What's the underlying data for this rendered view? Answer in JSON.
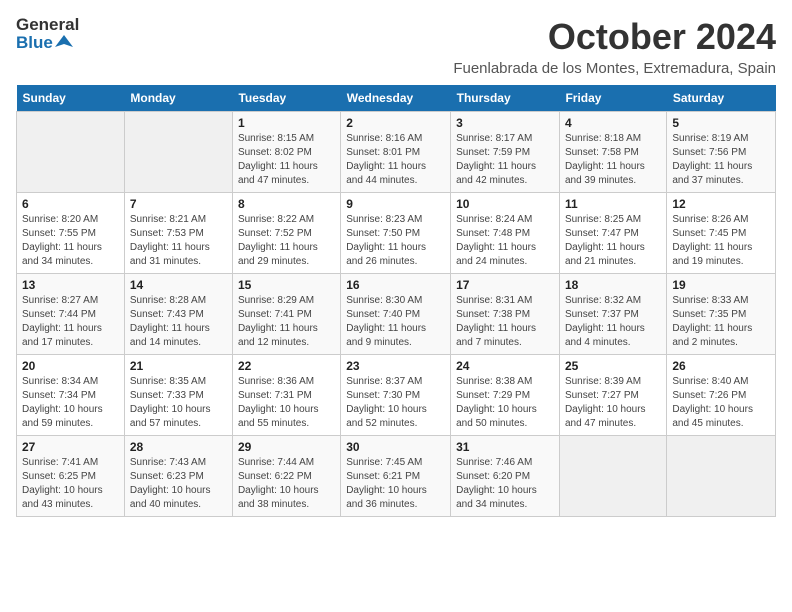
{
  "logo": {
    "general": "General",
    "blue": "Blue"
  },
  "title": "October 2024",
  "location": "Fuenlabrada de los Montes, Extremadura, Spain",
  "days_of_week": [
    "Sunday",
    "Monday",
    "Tuesday",
    "Wednesday",
    "Thursday",
    "Friday",
    "Saturday"
  ],
  "weeks": [
    [
      {
        "day": "",
        "sunrise": "",
        "sunset": "",
        "daylight": ""
      },
      {
        "day": "",
        "sunrise": "",
        "sunset": "",
        "daylight": ""
      },
      {
        "day": "1",
        "sunrise": "Sunrise: 8:15 AM",
        "sunset": "Sunset: 8:02 PM",
        "daylight": "Daylight: 11 hours and 47 minutes."
      },
      {
        "day": "2",
        "sunrise": "Sunrise: 8:16 AM",
        "sunset": "Sunset: 8:01 PM",
        "daylight": "Daylight: 11 hours and 44 minutes."
      },
      {
        "day": "3",
        "sunrise": "Sunrise: 8:17 AM",
        "sunset": "Sunset: 7:59 PM",
        "daylight": "Daylight: 11 hours and 42 minutes."
      },
      {
        "day": "4",
        "sunrise": "Sunrise: 8:18 AM",
        "sunset": "Sunset: 7:58 PM",
        "daylight": "Daylight: 11 hours and 39 minutes."
      },
      {
        "day": "5",
        "sunrise": "Sunrise: 8:19 AM",
        "sunset": "Sunset: 7:56 PM",
        "daylight": "Daylight: 11 hours and 37 minutes."
      }
    ],
    [
      {
        "day": "6",
        "sunrise": "Sunrise: 8:20 AM",
        "sunset": "Sunset: 7:55 PM",
        "daylight": "Daylight: 11 hours and 34 minutes."
      },
      {
        "day": "7",
        "sunrise": "Sunrise: 8:21 AM",
        "sunset": "Sunset: 7:53 PM",
        "daylight": "Daylight: 11 hours and 31 minutes."
      },
      {
        "day": "8",
        "sunrise": "Sunrise: 8:22 AM",
        "sunset": "Sunset: 7:52 PM",
        "daylight": "Daylight: 11 hours and 29 minutes."
      },
      {
        "day": "9",
        "sunrise": "Sunrise: 8:23 AM",
        "sunset": "Sunset: 7:50 PM",
        "daylight": "Daylight: 11 hours and 26 minutes."
      },
      {
        "day": "10",
        "sunrise": "Sunrise: 8:24 AM",
        "sunset": "Sunset: 7:48 PM",
        "daylight": "Daylight: 11 hours and 24 minutes."
      },
      {
        "day": "11",
        "sunrise": "Sunrise: 8:25 AM",
        "sunset": "Sunset: 7:47 PM",
        "daylight": "Daylight: 11 hours and 21 minutes."
      },
      {
        "day": "12",
        "sunrise": "Sunrise: 8:26 AM",
        "sunset": "Sunset: 7:45 PM",
        "daylight": "Daylight: 11 hours and 19 minutes."
      }
    ],
    [
      {
        "day": "13",
        "sunrise": "Sunrise: 8:27 AM",
        "sunset": "Sunset: 7:44 PM",
        "daylight": "Daylight: 11 hours and 17 minutes."
      },
      {
        "day": "14",
        "sunrise": "Sunrise: 8:28 AM",
        "sunset": "Sunset: 7:43 PM",
        "daylight": "Daylight: 11 hours and 14 minutes."
      },
      {
        "day": "15",
        "sunrise": "Sunrise: 8:29 AM",
        "sunset": "Sunset: 7:41 PM",
        "daylight": "Daylight: 11 hours and 12 minutes."
      },
      {
        "day": "16",
        "sunrise": "Sunrise: 8:30 AM",
        "sunset": "Sunset: 7:40 PM",
        "daylight": "Daylight: 11 hours and 9 minutes."
      },
      {
        "day": "17",
        "sunrise": "Sunrise: 8:31 AM",
        "sunset": "Sunset: 7:38 PM",
        "daylight": "Daylight: 11 hours and 7 minutes."
      },
      {
        "day": "18",
        "sunrise": "Sunrise: 8:32 AM",
        "sunset": "Sunset: 7:37 PM",
        "daylight": "Daylight: 11 hours and 4 minutes."
      },
      {
        "day": "19",
        "sunrise": "Sunrise: 8:33 AM",
        "sunset": "Sunset: 7:35 PM",
        "daylight": "Daylight: 11 hours and 2 minutes."
      }
    ],
    [
      {
        "day": "20",
        "sunrise": "Sunrise: 8:34 AM",
        "sunset": "Sunset: 7:34 PM",
        "daylight": "Daylight: 10 hours and 59 minutes."
      },
      {
        "day": "21",
        "sunrise": "Sunrise: 8:35 AM",
        "sunset": "Sunset: 7:33 PM",
        "daylight": "Daylight: 10 hours and 57 minutes."
      },
      {
        "day": "22",
        "sunrise": "Sunrise: 8:36 AM",
        "sunset": "Sunset: 7:31 PM",
        "daylight": "Daylight: 10 hours and 55 minutes."
      },
      {
        "day": "23",
        "sunrise": "Sunrise: 8:37 AM",
        "sunset": "Sunset: 7:30 PM",
        "daylight": "Daylight: 10 hours and 52 minutes."
      },
      {
        "day": "24",
        "sunrise": "Sunrise: 8:38 AM",
        "sunset": "Sunset: 7:29 PM",
        "daylight": "Daylight: 10 hours and 50 minutes."
      },
      {
        "day": "25",
        "sunrise": "Sunrise: 8:39 AM",
        "sunset": "Sunset: 7:27 PM",
        "daylight": "Daylight: 10 hours and 47 minutes."
      },
      {
        "day": "26",
        "sunrise": "Sunrise: 8:40 AM",
        "sunset": "Sunset: 7:26 PM",
        "daylight": "Daylight: 10 hours and 45 minutes."
      }
    ],
    [
      {
        "day": "27",
        "sunrise": "Sunrise: 7:41 AM",
        "sunset": "Sunset: 6:25 PM",
        "daylight": "Daylight: 10 hours and 43 minutes."
      },
      {
        "day": "28",
        "sunrise": "Sunrise: 7:43 AM",
        "sunset": "Sunset: 6:23 PM",
        "daylight": "Daylight: 10 hours and 40 minutes."
      },
      {
        "day": "29",
        "sunrise": "Sunrise: 7:44 AM",
        "sunset": "Sunset: 6:22 PM",
        "daylight": "Daylight: 10 hours and 38 minutes."
      },
      {
        "day": "30",
        "sunrise": "Sunrise: 7:45 AM",
        "sunset": "Sunset: 6:21 PM",
        "daylight": "Daylight: 10 hours and 36 minutes."
      },
      {
        "day": "31",
        "sunrise": "Sunrise: 7:46 AM",
        "sunset": "Sunset: 6:20 PM",
        "daylight": "Daylight: 10 hours and 34 minutes."
      },
      {
        "day": "",
        "sunrise": "",
        "sunset": "",
        "daylight": ""
      },
      {
        "day": "",
        "sunrise": "",
        "sunset": "",
        "daylight": ""
      }
    ]
  ]
}
